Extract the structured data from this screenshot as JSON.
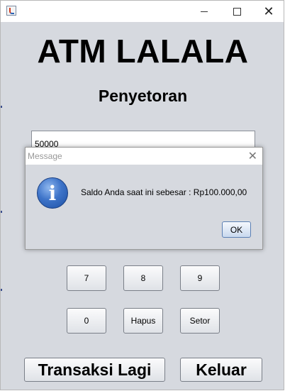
{
  "window": {
    "title": "",
    "close_glyph": "✕"
  },
  "app": {
    "title": "ATM LALALA",
    "subtitle": "Penyetoran"
  },
  "amount_input": {
    "value": "50000"
  },
  "keypad": {
    "keys": [
      "7",
      "8",
      "9",
      "0",
      "Hapus",
      "Setor"
    ]
  },
  "footer": {
    "again_label": "Transaksi Lagi",
    "exit_label": "Keluar"
  },
  "dialog": {
    "title": "Message",
    "close_glyph": "✕",
    "icon_glyph": "i",
    "message": "Saldo Anda saat ini sebesar : Rp100.000,00",
    "ok_label": "OK"
  },
  "icons": [
    "java-app-icon",
    "minimize-icon",
    "maximize-icon",
    "close-icon",
    "info-icon"
  ]
}
